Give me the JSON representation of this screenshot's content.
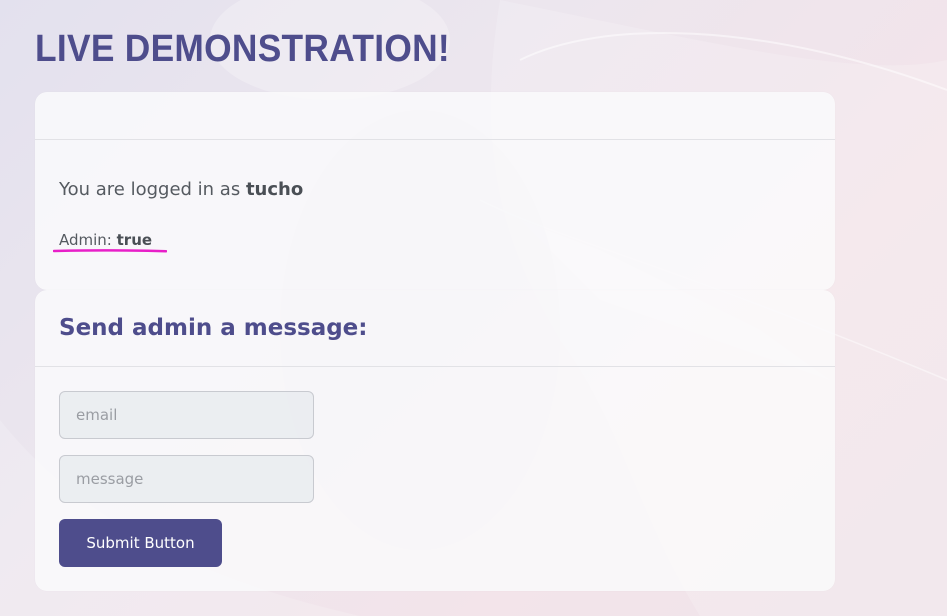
{
  "header": {
    "title": "LIVE DEMONSTRATION!"
  },
  "status_card": {
    "logged_in_prefix": "You are logged in as ",
    "username": "tucho",
    "admin_label": "Admin: ",
    "admin_value": "true"
  },
  "message_card": {
    "title": "Send admin a message:",
    "email_placeholder": "email",
    "message_placeholder": "message",
    "submit_label": "Submit Button"
  },
  "colors": {
    "accent": "#4e4d8c",
    "highlight_underline": "#e81fc8",
    "card_background": "#fafafb"
  }
}
